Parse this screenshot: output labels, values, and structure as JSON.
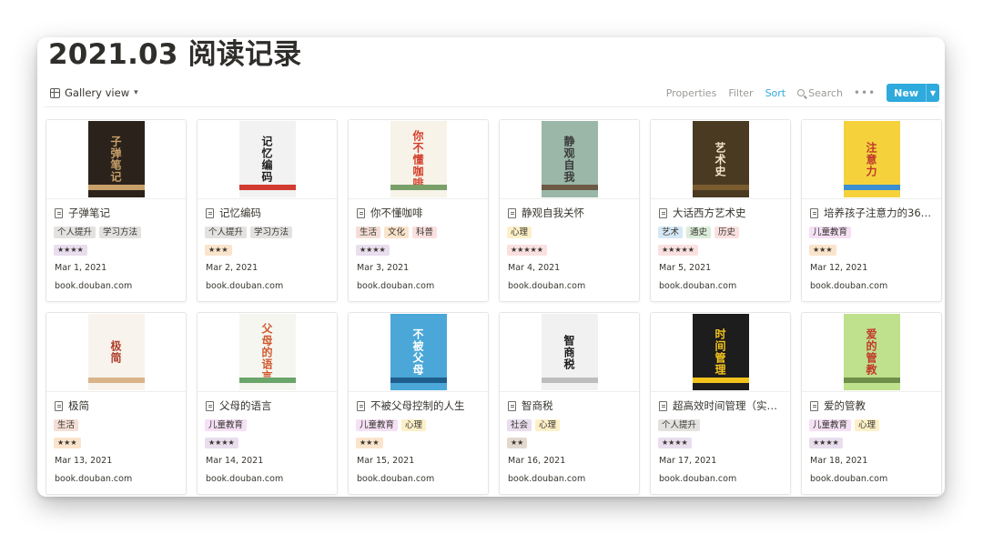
{
  "page": {
    "title": "2021.03 阅读记录"
  },
  "toolbar": {
    "view_label": "Gallery view",
    "properties": "Properties",
    "filter": "Filter",
    "sort": "Sort",
    "search": "Search",
    "new_label": "New",
    "accent": "#2eaadc"
  },
  "tag_colors": {
    "个人提升": "#e3e2e0",
    "学习方法": "#e3e2e0",
    "生活": "#f4dfd6",
    "文化": "#fbe4cc",
    "科普": "#fbe0e0",
    "心理": "#fdf0c8",
    "艺术": "#d6e8f5",
    "通史": "#dbeddb",
    "历史": "#fbe0e0",
    "儿童教育": "#f5e0f5",
    "社会": "#e8deee"
  },
  "cards": [
    {
      "title": "子弹笔记",
      "tags": [
        "个人提升",
        "学习方法"
      ],
      "rating": "★★★★",
      "rating_color": "#e8deee",
      "date": "Mar 1, 2021",
      "source": "book.douban.com",
      "cover": {
        "bg": "#2b231b",
        "fg": "#c8a06a",
        "text": "子弹笔记",
        "stripe": "#c8a06a"
      }
    },
    {
      "title": "记忆编码",
      "tags": [
        "个人提升",
        "学习方法"
      ],
      "rating": "★★★",
      "rating_color": "#fbe4cc",
      "date": "Mar 2, 2021",
      "source": "book.douban.com",
      "cover": {
        "bg": "#f2f2f2",
        "fg": "#1f1f1f",
        "text": "记忆编码",
        "stripe": "#d23b30"
      }
    },
    {
      "title": "你不懂咖啡",
      "tags": [
        "生活",
        "文化",
        "科普"
      ],
      "rating": "★★★★",
      "rating_color": "#e8deee",
      "date": "Mar 3, 2021",
      "source": "book.douban.com",
      "cover": {
        "bg": "#f7f3e8",
        "fg": "#d43d2a",
        "text": "你不懂咖啡",
        "stripe": "#7aa06a"
      }
    },
    {
      "title": "静观自我关怀",
      "tags": [
        "心理"
      ],
      "rating": "★★★★★",
      "rating_color": "#fbe0e0",
      "date": "Mar 4, 2021",
      "source": "book.douban.com",
      "cover": {
        "bg": "#9ab7a8",
        "fg": "#3b3b3b",
        "text": "静观自我",
        "stripe": "#6c5a45"
      }
    },
    {
      "title": "大话西方艺术史",
      "tags": [
        "艺术",
        "通史",
        "历史"
      ],
      "rating": "★★★★★",
      "rating_color": "#fbe0e0",
      "date": "Mar 5, 2021",
      "source": "book.douban.com",
      "cover": {
        "bg": "#4a3a22",
        "fg": "#f1e5c8",
        "text": "艺术史",
        "stripe": "#7a5c2e"
      }
    },
    {
      "title": "培养孩子注意力的36…",
      "tags": [
        "儿童教育"
      ],
      "rating": "★★★",
      "rating_color": "#fbe4cc",
      "date": "Mar 12, 2021",
      "source": "book.douban.com",
      "cover": {
        "bg": "#f5d23c",
        "fg": "#c0392b",
        "text": "注意力",
        "stripe": "#3b8fd0"
      }
    },
    {
      "title": "极简",
      "tags": [
        "生活"
      ],
      "rating": "★★★",
      "rating_color": "#fbe4cc",
      "date": "Mar 13, 2021",
      "source": "book.douban.com",
      "cover": {
        "bg": "#f8f3ec",
        "fg": "#b0402d",
        "text": "极简",
        "stripe": "#d9b48a"
      }
    },
    {
      "title": "父母的语言",
      "tags": [
        "儿童教育"
      ],
      "rating": "★★★★",
      "rating_color": "#e8deee",
      "date": "Mar 14, 2021",
      "source": "book.douban.com",
      "cover": {
        "bg": "#f6f6f1",
        "fg": "#d2582f",
        "text": "父母的语言",
        "stripe": "#6aa56a"
      }
    },
    {
      "title": "不被父母控制的人生",
      "tags": [
        "儿童教育",
        "心理"
      ],
      "rating": "★★★",
      "rating_color": "#fbe4cc",
      "date": "Mar 15, 2021",
      "source": "book.douban.com",
      "cover": {
        "bg": "#4aa7d8",
        "fg": "#ffffff",
        "text": "不被父母",
        "stripe": "#1f5e8c"
      }
    },
    {
      "title": "智商税",
      "tags": [
        "社会",
        "心理"
      ],
      "rating": "★★",
      "rating_color": "#e3d9cf",
      "date": "Mar 16, 2021",
      "source": "book.douban.com",
      "cover": {
        "bg": "#f1f1f1",
        "fg": "#1d1d1d",
        "text": "智商税",
        "stripe": "#bdbdbd"
      }
    },
    {
      "title": "超高效时间管理（实践…",
      "tags": [
        "个人提升"
      ],
      "rating": "★★★★",
      "rating_color": "#e8deee",
      "date": "Mar 17, 2021",
      "source": "book.douban.com",
      "cover": {
        "bg": "#1d1d1d",
        "fg": "#f3c31c",
        "text": "时间管理",
        "stripe": "#f3c31c"
      }
    },
    {
      "title": "爱的管教",
      "tags": [
        "儿童教育",
        "心理"
      ],
      "rating": "★★★★",
      "rating_color": "#e8deee",
      "date": "Mar 18, 2021",
      "source": "book.douban.com",
      "cover": {
        "bg": "#bfe08c",
        "fg": "#c0392b",
        "text": "爱的管教",
        "stripe": "#6e8f4a"
      }
    }
  ]
}
